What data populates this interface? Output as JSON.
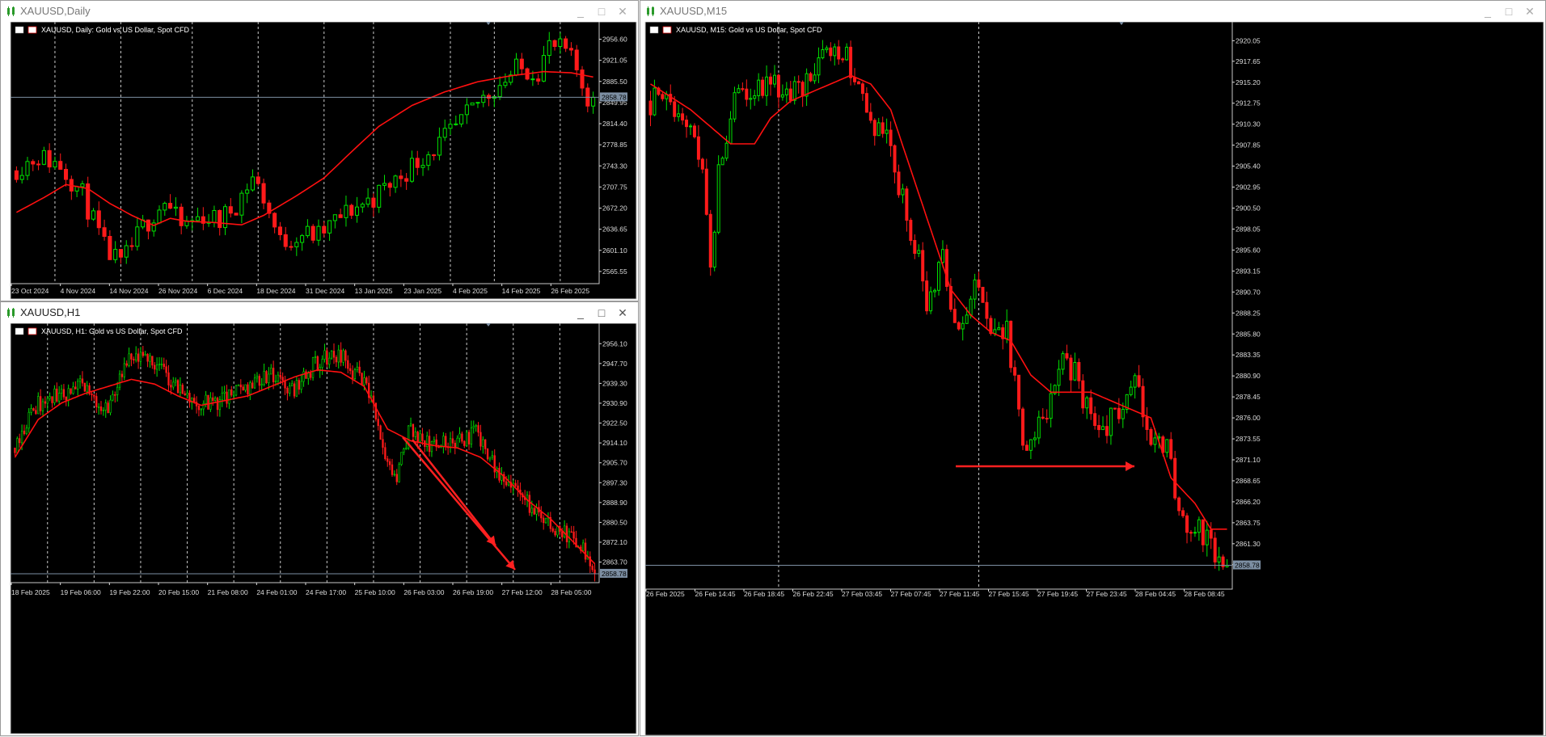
{
  "windows": [
    {
      "id": "daily",
      "title": "XAUUSD,Daily",
      "active": false,
      "controls": {
        "minimize": "_",
        "maximize": "□",
        "close": "✕"
      }
    },
    {
      "id": "h1",
      "title": "XAUUSD,H1",
      "active": true,
      "controls": {
        "minimize": "_",
        "maximize": "□",
        "close": "✕"
      }
    },
    {
      "id": "m15",
      "title": "XAUUSD,M15",
      "active": false,
      "controls": {
        "minimize": "_",
        "maximize": "□",
        "close": "✕"
      }
    }
  ],
  "colors": {
    "background": "#000000",
    "bull": "#00e000",
    "bear": "#ff1a1a",
    "ma": "#ff1010",
    "grid": "#c8c8c8",
    "axis_text": "#dddddd",
    "bid_line": "#7d8fa3",
    "arrow": "#ff2020"
  },
  "chart_data": [
    {
      "type": "candlestick",
      "symbol_header": "XAUUSD, Daily:  Gold vs US Dollar, Spot CFD",
      "current_price": "2858.78",
      "ylim": [
        2545,
        2975
      ],
      "y_ticks": [
        "2956.60",
        "2921.05",
        "2885.50",
        "2849.95",
        "2814.40",
        "2778.85",
        "2743.30",
        "2707.75",
        "2672.20",
        "2636.65",
        "2601.10",
        "2565.55"
      ],
      "x_ticks": [
        "23 Oct 2024",
        "4 Nov 2024",
        "14 Nov 2024",
        "26 Nov 2024",
        "6 Dec 2024",
        "18 Dec 2024",
        "31 Dec 2024",
        "13 Jan 2025",
        "23 Jan 2025",
        "4 Feb 2025",
        "14 Feb 2025",
        "26 Feb 2025"
      ],
      "path": [
        [
          0,
          2735
        ],
        [
          5,
          2760
        ],
        [
          9,
          2745
        ],
        [
          13,
          2695
        ],
        [
          17,
          2605
        ],
        [
          20,
          2575
        ],
        [
          24,
          2640
        ],
        [
          28,
          2685
        ],
        [
          31,
          2640
        ],
        [
          35,
          2660
        ],
        [
          38,
          2650
        ],
        [
          41,
          2680
        ],
        [
          44,
          2725
        ],
        [
          46,
          2690
        ],
        [
          49,
          2615
        ],
        [
          53,
          2630
        ],
        [
          56,
          2625
        ],
        [
          59,
          2650
        ],
        [
          62,
          2670
        ],
        [
          66,
          2690
        ],
        [
          70,
          2720
        ],
        [
          75,
          2760
        ],
        [
          78,
          2780
        ],
        [
          82,
          2815
        ],
        [
          85,
          2850
        ],
        [
          88,
          2875
        ],
        [
          92,
          2905
        ],
        [
          96,
          2905
        ],
        [
          98,
          2945
        ],
        [
          101,
          2935
        ],
        [
          103,
          2905
        ],
        [
          105,
          2860
        ]
      ],
      "ma": [
        [
          0,
          2665
        ],
        [
          5,
          2690
        ],
        [
          9,
          2712
        ],
        [
          13,
          2705
        ],
        [
          17,
          2680
        ],
        [
          21,
          2660
        ],
        [
          25,
          2643
        ],
        [
          28,
          2655
        ],
        [
          31,
          2650
        ],
        [
          36,
          2648
        ],
        [
          41,
          2644
        ],
        [
          45,
          2660
        ],
        [
          51,
          2693
        ],
        [
          56,
          2723
        ],
        [
          61,
          2767
        ],
        [
          66,
          2810
        ],
        [
          72,
          2845
        ],
        [
          78,
          2868
        ],
        [
          84,
          2885
        ],
        [
          90,
          2895
        ],
        [
          96,
          2902
        ],
        [
          101,
          2900
        ],
        [
          105,
          2893
        ]
      ],
      "n_candles": 106,
      "amp": 28,
      "vgrid": [
        7,
        19,
        32,
        44,
        56,
        65,
        79,
        87,
        99
      ]
    },
    {
      "type": "candlestick",
      "symbol_header": "XAUUSD, H1:  Gold vs US Dollar, Spot CFD",
      "current_price": "2858.78",
      "ylim": [
        2855,
        2962
      ],
      "y_ticks": [
        "2956.10",
        "2947.70",
        "2939.30",
        "2930.90",
        "2922.50",
        "2914.10",
        "2905.70",
        "2897.30",
        "2888.90",
        "2880.50",
        "2872.10",
        "2863.70"
      ],
      "x_ticks": [
        "18 Feb 2025",
        "19 Feb 06:00",
        "19 Feb 22:00",
        "20 Feb 15:00",
        "21 Feb 08:00",
        "24 Feb 01:00",
        "24 Feb 17:00",
        "25 Feb 10:00",
        "26 Feb 03:00",
        "26 Feb 19:00",
        "27 Feb 12:00",
        "28 Feb 05:00"
      ],
      "path": [
        [
          0,
          2912
        ],
        [
          10,
          2930
        ],
        [
          20,
          2934
        ],
        [
          30,
          2938
        ],
        [
          40,
          2928
        ],
        [
          50,
          2948
        ],
        [
          60,
          2950
        ],
        [
          70,
          2938
        ],
        [
          80,
          2930
        ],
        [
          90,
          2932
        ],
        [
          100,
          2938
        ],
        [
          110,
          2943
        ],
        [
          120,
          2936
        ],
        [
          130,
          2948
        ],
        [
          140,
          2952
        ],
        [
          150,
          2940
        ],
        [
          155,
          2930
        ],
        [
          160,
          2905
        ],
        [
          165,
          2898
        ],
        [
          170,
          2920
        ],
        [
          180,
          2912
        ],
        [
          190,
          2915
        ],
        [
          200,
          2918
        ],
        [
          210,
          2900
        ],
        [
          220,
          2890
        ],
        [
          230,
          2880
        ],
        [
          240,
          2875
        ],
        [
          250,
          2862
        ]
      ],
      "ma": [
        [
          0,
          2908
        ],
        [
          10,
          2924
        ],
        [
          20,
          2931
        ],
        [
          30,
          2935
        ],
        [
          40,
          2938
        ],
        [
          50,
          2941
        ],
        [
          60,
          2939
        ],
        [
          70,
          2934
        ],
        [
          80,
          2930
        ],
        [
          90,
          2932
        ],
        [
          100,
          2934
        ],
        [
          110,
          2938
        ],
        [
          120,
          2942
        ],
        [
          130,
          2945
        ],
        [
          140,
          2944
        ],
        [
          150,
          2938
        ],
        [
          160,
          2920
        ],
        [
          170,
          2915
        ],
        [
          180,
          2913
        ],
        [
          190,
          2912
        ],
        [
          200,
          2908
        ],
        [
          210,
          2900
        ],
        [
          220,
          2890
        ],
        [
          230,
          2882
        ],
        [
          240,
          2872
        ],
        [
          250,
          2862
        ]
      ],
      "n_candles": 250,
      "amp": 5.5,
      "vgrid": [
        14,
        34,
        54,
        74,
        94,
        114,
        134,
        154,
        174,
        194,
        214,
        234
      ]
    },
    {
      "type": "candlestick",
      "symbol_header": "XAUUSD, M15:  Gold vs US Dollar, Spot CFD",
      "current_price": "2858.78",
      "ylim": [
        2856,
        2921.5
      ],
      "y_ticks": [
        "2920.05",
        "2917.65",
        "2915.20",
        "2912.75",
        "2910.30",
        "2907.85",
        "2905.40",
        "2902.95",
        "2900.50",
        "2898.05",
        "2895.60",
        "2893.15",
        "2890.70",
        "2888.25",
        "2885.80",
        "2883.35",
        "2880.90",
        "2878.45",
        "2876.00",
        "2873.55",
        "2871.10",
        "2868.65",
        "2866.20",
        "2863.75",
        "2861.30",
        "2858.85"
      ],
      "x_ticks": [
        "26 Feb 2025",
        "26 Feb 14:45",
        "26 Feb 18:45",
        "26 Feb 22:45",
        "27 Feb 03:45",
        "27 Feb 07:45",
        "27 Feb 11:45",
        "27 Feb 15:45",
        "27 Feb 19:45",
        "27 Feb 23:45",
        "28 Feb 04:45",
        "28 Feb 08:45"
      ],
      "path": [
        [
          0,
          2913
        ],
        [
          5,
          2913
        ],
        [
          10,
          2911
        ],
        [
          14,
          2905
        ],
        [
          16,
          2893
        ],
        [
          18,
          2905
        ],
        [
          22,
          2913
        ],
        [
          28,
          2915
        ],
        [
          35,
          2914
        ],
        [
          40,
          2915
        ],
        [
          45,
          2919
        ],
        [
          50,
          2918
        ],
        [
          55,
          2912
        ],
        [
          60,
          2908
        ],
        [
          65,
          2900
        ],
        [
          70,
          2890
        ],
        [
          74,
          2895
        ],
        [
          78,
          2885
        ],
        [
          82,
          2891
        ],
        [
          86,
          2886
        ],
        [
          90,
          2886
        ],
        [
          94,
          2873
        ],
        [
          100,
          2876
        ],
        [
          104,
          2884
        ],
        [
          108,
          2880
        ],
        [
          112,
          2875
        ],
        [
          118,
          2876
        ],
        [
          122,
          2880
        ],
        [
          126,
          2874
        ],
        [
          130,
          2872
        ],
        [
          134,
          2863
        ],
        [
          138,
          2863
        ],
        [
          142,
          2860
        ],
        [
          144,
          2859
        ]
      ],
      "ma": [
        [
          0,
          2915
        ],
        [
          10,
          2912
        ],
        [
          15,
          2910
        ],
        [
          20,
          2908
        ],
        [
          26,
          2908
        ],
        [
          30,
          2911
        ],
        [
          35,
          2913
        ],
        [
          40,
          2914
        ],
        [
          45,
          2915
        ],
        [
          50,
          2916
        ],
        [
          55,
          2915
        ],
        [
          60,
          2912
        ],
        [
          65,
          2905
        ],
        [
          70,
          2898
        ],
        [
          75,
          2891
        ],
        [
          80,
          2888
        ],
        [
          85,
          2886
        ],
        [
          90,
          2885
        ],
        [
          95,
          2881
        ],
        [
          100,
          2879
        ],
        [
          105,
          2879
        ],
        [
          110,
          2879
        ],
        [
          115,
          2878
        ],
        [
          120,
          2877
        ],
        [
          125,
          2876
        ],
        [
          130,
          2869
        ],
        [
          136,
          2866
        ],
        [
          140,
          2863
        ]
      ],
      "n_candles": 145,
      "amp": 2.3,
      "vgrid": [
        32,
        82
      ]
    }
  ]
}
